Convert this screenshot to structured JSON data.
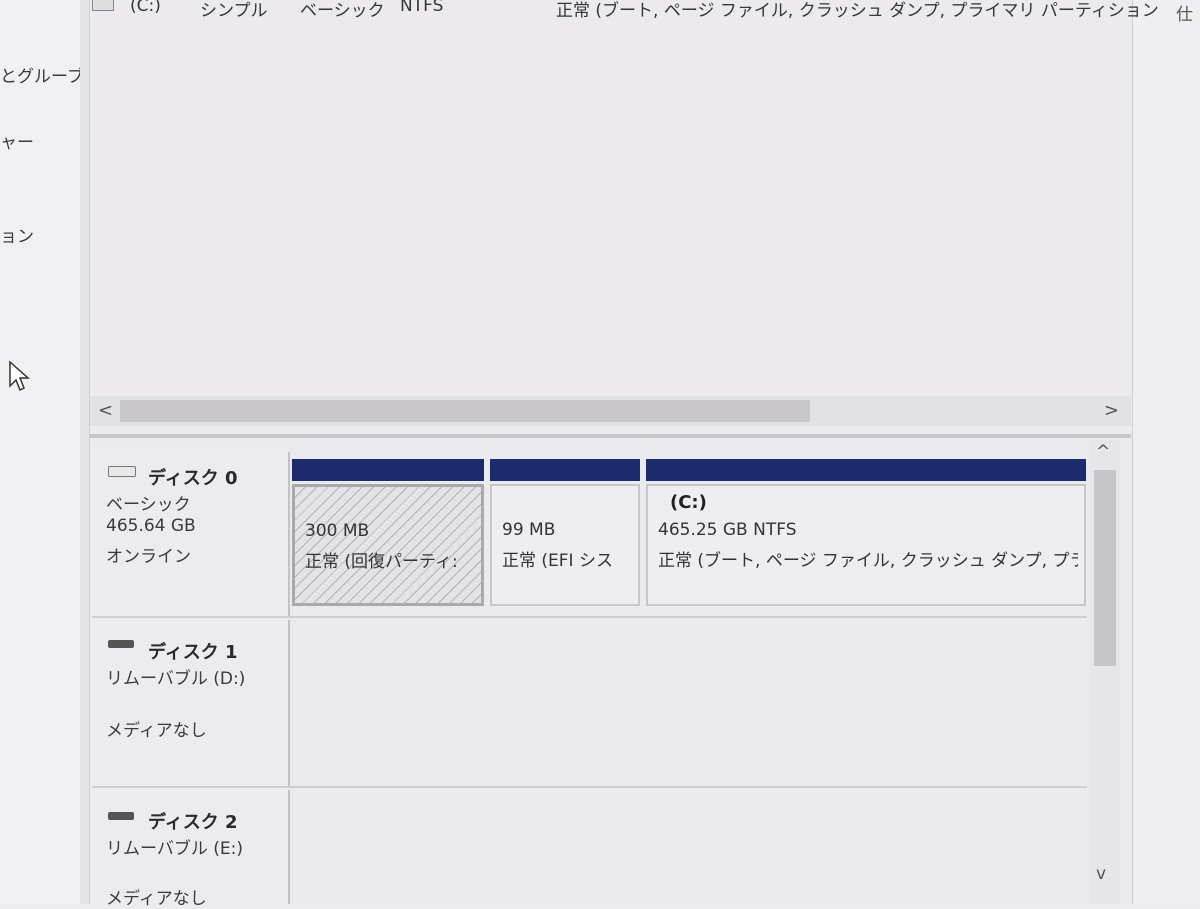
{
  "nav": {
    "items": [
      "とグルーブ",
      "ャー",
      "ョン"
    ]
  },
  "volume_list": {
    "row": {
      "volume": "(C:)",
      "layout": "シンプル",
      "type": "ベーシック",
      "fs": "NTFS",
      "status": "正常 (ブート, ページ ファイル, クラッシュ ダンプ, プライマリ パーティション"
    },
    "right_edge_glyph": "仕"
  },
  "scrollbars": {
    "left_arrow": "<",
    "right_arrow": ">",
    "up_arrow": "^",
    "down_arrow": "v"
  },
  "disks": [
    {
      "name": "ディスク 0",
      "type": "ベーシック",
      "size": "465.64 GB",
      "state": "オンライン",
      "partitions": [
        {
          "size": "300 MB",
          "status": "正常 (回復パーティ:"
        },
        {
          "size": "99 MB",
          "status": "正常 (EFI シス"
        },
        {
          "title": "(C:)",
          "size": "465.25 GB NTFS",
          "status": "正常 (ブート, ページ ファイル, クラッシュ ダンプ, プラ-"
        }
      ]
    },
    {
      "name": "ディスク 1",
      "type": "リムーバブル (D:)",
      "state": "メディアなし"
    },
    {
      "name": "ディスク 2",
      "type": "リムーバブル (E:)",
      "state": "メディアなし"
    }
  ],
  "colors": {
    "partition_bar": "#1c2a6e",
    "background": "#ecebef"
  }
}
